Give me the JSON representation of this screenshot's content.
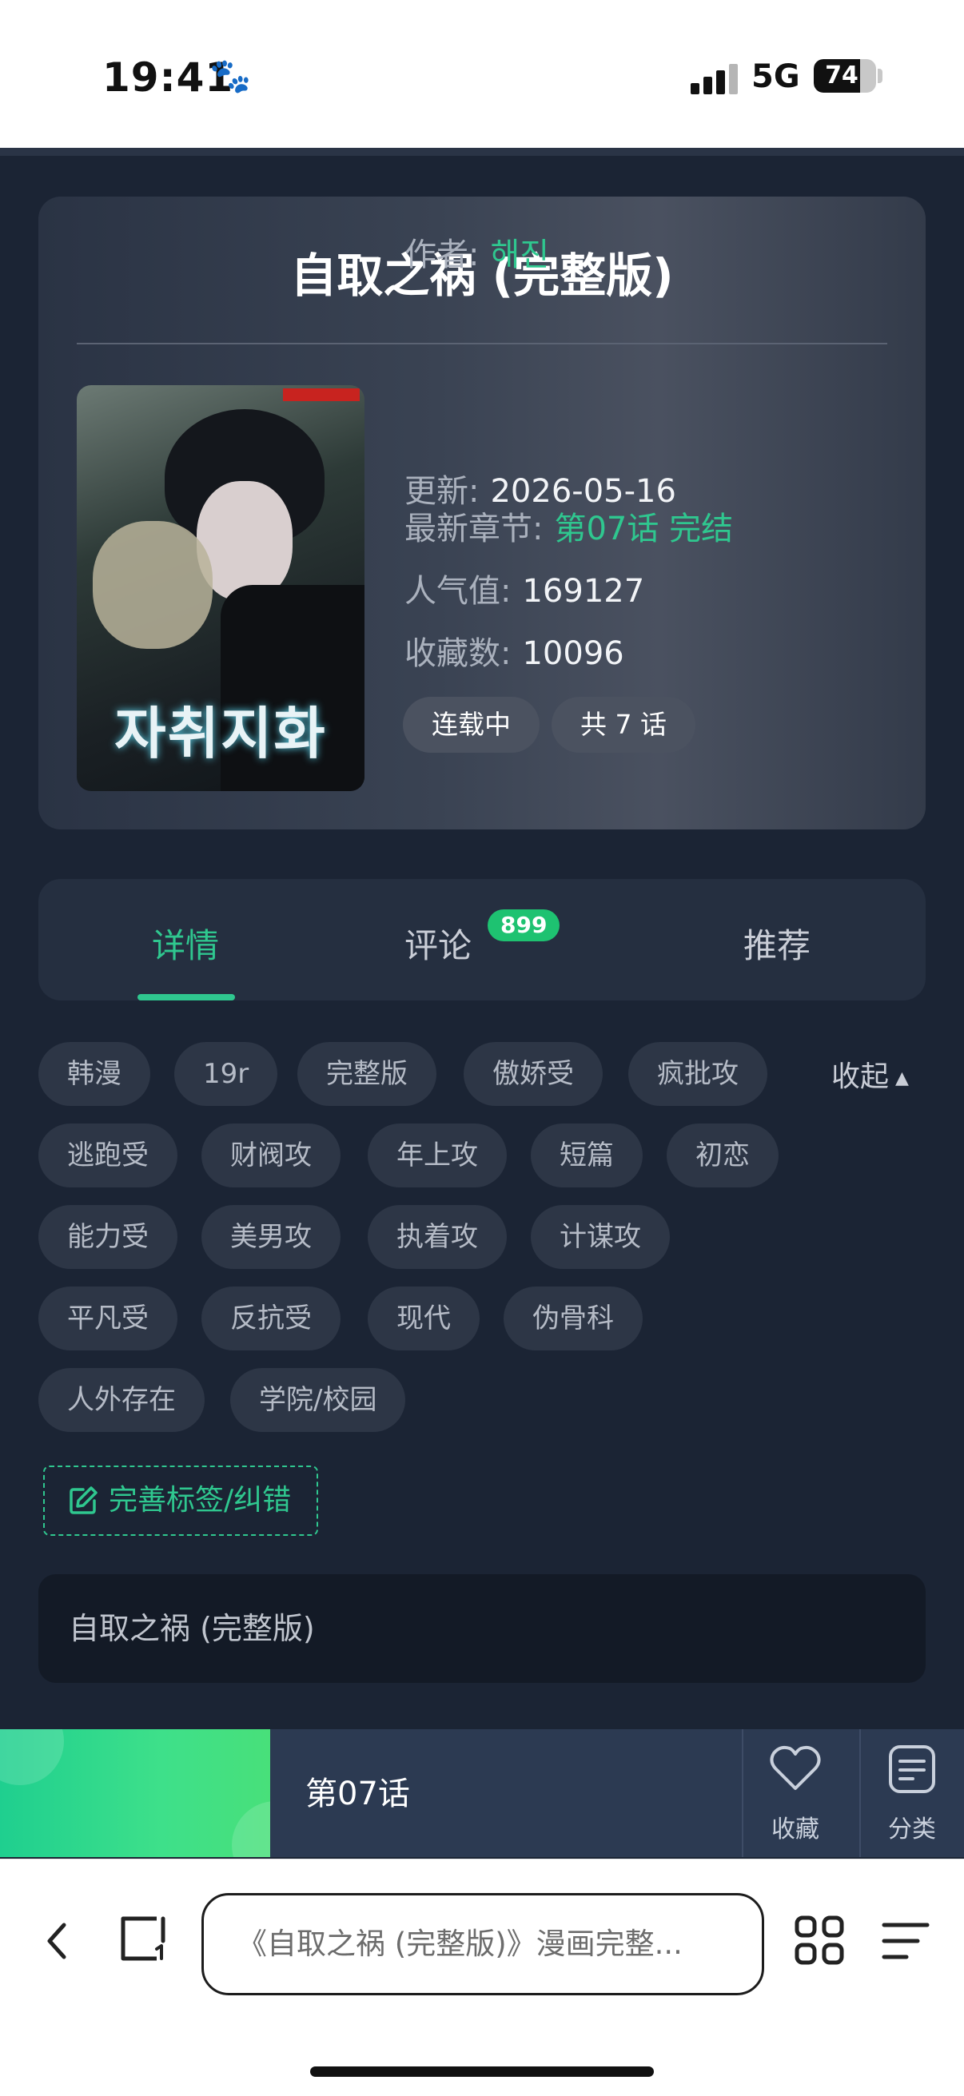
{
  "status_bar": {
    "time": "19:41",
    "network": "5G",
    "battery": "74",
    "battery_level": 0.74
  },
  "card": {
    "title": "自取之祸 (完整版)",
    "cover_title": "자취지화",
    "author_label": "作者:",
    "author": "해진",
    "update_label": "更新:",
    "update_date": "2026-05-16",
    "latest_label": "最新章节:",
    "latest_chapter": "第07话 完结",
    "popularity_label": "人气值:",
    "popularity": "169127",
    "favorites_label": "收藏数:",
    "favorites": "10096",
    "status_pill": "连载中",
    "episodes_pill": "共 7 话"
  },
  "tabs": [
    {
      "label": "详情"
    },
    {
      "label": "评论",
      "badge": "899"
    },
    {
      "label": "推荐"
    }
  ],
  "tags": [
    "韩漫",
    "19r",
    "完整版",
    "傲娇受",
    "疯批攻",
    "逃跑受",
    "财阀攻",
    "年上攻",
    "短篇",
    "初恋",
    "能力受",
    "美男攻",
    "执着攻",
    "计谋攻",
    "平凡受",
    "反抗受",
    "现代",
    "伪骨科",
    "人外存在",
    "学院/校园"
  ],
  "collapse_label": "收起",
  "edit_tags_label": "完善标签/纠错",
  "description": "自取之祸 (完整版)",
  "bottom_bar": {
    "chapter": "第07话",
    "favorite_label": "收藏",
    "category_label": "分类"
  },
  "browser": {
    "url_text": "《自取之祸 (完整版)》漫画完整..."
  },
  "colors": {
    "accent": "#2fc78f",
    "background": "#1b2434",
    "badge": "#1ec271"
  },
  "icons": [
    "paw-icon",
    "signal-icon",
    "battery-icon",
    "heart-icon",
    "category-icon",
    "edit-icon",
    "back-icon",
    "tabs-icon",
    "grid-icon",
    "menu-icon"
  ]
}
